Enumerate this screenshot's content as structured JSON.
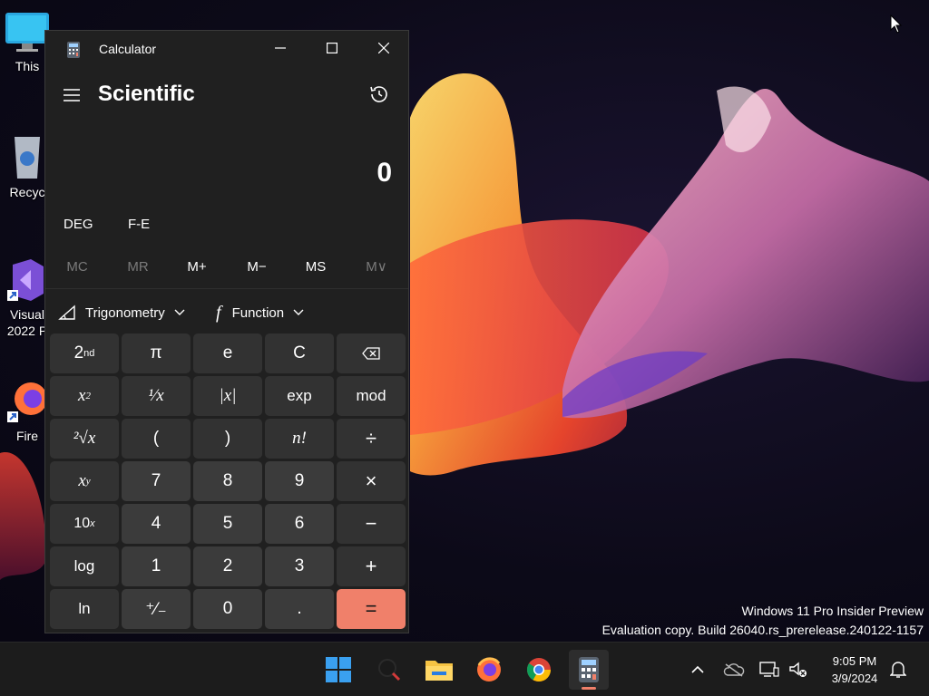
{
  "desktop": {
    "icons": [
      {
        "name": "This PC",
        "label": "This"
      },
      {
        "name": "Recycle Bin",
        "label": "Recyc"
      },
      {
        "name": "Visual Studio 2022",
        "label1": "Visual",
        "label2": "2022 P"
      },
      {
        "name": "Firefox",
        "label": "Fire"
      }
    ],
    "watermark": {
      "line1": "Windows 11 Pro Insider Preview",
      "line2": "Evaluation copy. Build 26040.rs_prerelease.240122-1157"
    }
  },
  "calculator": {
    "window_title": "Calculator",
    "mode": "Scientific",
    "display_value": "0",
    "angle_unit": "DEG",
    "notation": "F-E",
    "memory": [
      {
        "label": "MC",
        "enabled": false
      },
      {
        "label": "MR",
        "enabled": false
      },
      {
        "label": "M+",
        "enabled": true
      },
      {
        "label": "M−",
        "enabled": true
      },
      {
        "label": "MS",
        "enabled": true
      },
      {
        "label": "M∨",
        "enabled": false
      }
    ],
    "trig_label": "Trigonometry",
    "function_label": "Function",
    "keys": {
      "second": {
        "base": "2",
        "sup": "nd"
      },
      "pi": "π",
      "e": "e",
      "clear": "C",
      "x_squared": {
        "base": "x",
        "sup": "2"
      },
      "reciprocal": "¹⁄x",
      "abs": "|x|",
      "exp": "exp",
      "mod": "mod",
      "sqrt": "²√x",
      "open_paren": "(",
      "close_paren": ")",
      "factorial": "n!",
      "divide": "÷",
      "x_pow_y": {
        "base": "x",
        "sup": "y"
      },
      "seven": "7",
      "eight": "8",
      "nine": "9",
      "multiply": "×",
      "ten_pow_x": {
        "base": "10",
        "sup": "x"
      },
      "four": "4",
      "five": "5",
      "six": "6",
      "minus": "−",
      "log": "log",
      "one": "1",
      "two": "2",
      "three": "3",
      "plus": "+",
      "ln": "ln",
      "negate": "⁺⁄₋",
      "zero": "0",
      "decimal": ".",
      "equals": "="
    }
  },
  "taskbar": {
    "apps": [
      "Start",
      "Search",
      "File Explorer",
      "Firefox",
      "Chrome",
      "Calculator"
    ],
    "active_app": "Calculator",
    "clock_time": "9:05 PM",
    "clock_date": "3/9/2024"
  },
  "colors": {
    "accent": "#f0806a",
    "window_bg": "#202020",
    "taskbar_bg": "#1c1c1c"
  }
}
